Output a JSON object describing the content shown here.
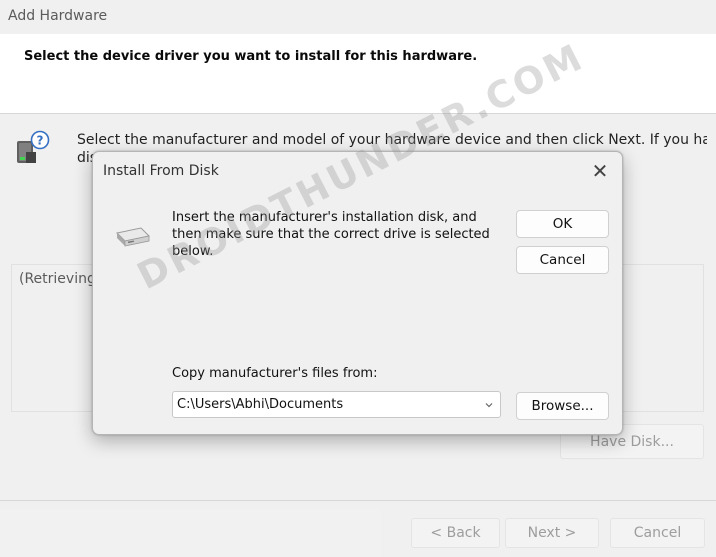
{
  "wizard": {
    "title": "Add Hardware",
    "header": "Select the device driver you want to install for this hardware.",
    "description_line1": "Select the manufacturer and model of your hardware device and then click Next. If you have a",
    "description_line2_prefix": "dis",
    "list_text": "(Retrieving",
    "buttons": {
      "have_disk": "Have Disk...",
      "back": "< Back",
      "next": "Next >",
      "cancel": "Cancel"
    },
    "icon": "hardware-help-icon"
  },
  "dialog": {
    "title": "Install From Disk",
    "close_glyph": "✕",
    "message": "Insert the manufacturer's installation disk, and then make sure that the correct drive is selected below.",
    "ok_label": "OK",
    "cancel_label": "Cancel",
    "copy_label": "Copy manufacturer's files from:",
    "path_value": "C:\\Users\\Abhi\\Documents",
    "browse_label": "Browse...",
    "icon": "disk-drive-icon"
  },
  "watermark": "DROIDTHUNDER.COM"
}
